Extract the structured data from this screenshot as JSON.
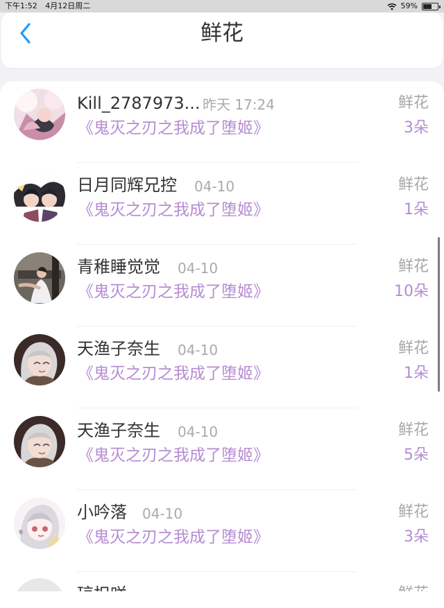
{
  "status_bar": {
    "time": "下午1:52",
    "date": "4月12日周二",
    "battery": "59%",
    "battery_level_percent": 59,
    "icons": [
      "wifi-icon",
      "battery-icon"
    ]
  },
  "header": {
    "title": "鲜花",
    "back_icon": "chevron-left-icon"
  },
  "list": [
    {
      "name": "Kill_2787973...",
      "time": "昨天 17:24",
      "book": "《鬼灭之刃之我成了堕姬》",
      "gift": "鲜花",
      "count": "3朵",
      "avatar": "avatar-kill"
    },
    {
      "name": "日月同辉兄控",
      "time": "04-10",
      "book": "《鬼灭之刃之我成了堕姬》",
      "gift": "鲜花",
      "count": "1朵",
      "avatar": "avatar-sun-moon"
    },
    {
      "name": "青稚睡觉觉",
      "time": "04-10",
      "book": "《鬼灭之刃之我成了堕姬》",
      "gift": "鲜花",
      "count": "10朵",
      "avatar": "avatar-qingzhi"
    },
    {
      "name": "天渔子奈生",
      "time": "04-10",
      "book": "《鬼灭之刃之我成了堕姬》",
      "gift": "鲜花",
      "count": "1朵",
      "avatar": "avatar-tianyu"
    },
    {
      "name": "天渔子奈生",
      "time": "04-10",
      "book": "《鬼灭之刃之我成了堕姬》",
      "gift": "鲜花",
      "count": "5朵",
      "avatar": "avatar-tianyu"
    },
    {
      "name": "小吟落",
      "time": "04-10",
      "book": "《鬼灭之刃之我成了堕姬》",
      "gift": "鲜花",
      "count": "3朵",
      "avatar": "avatar-xiaoyinluo"
    }
  ],
  "partial_row": {
    "name": "琼担咲",
    "gift": "鲜花"
  },
  "colors": {
    "background": "#f2f2f4",
    "card": "#ffffff",
    "accent_blue": "#1a9bff",
    "primary_text": "#333333",
    "secondary_text": "#aaaaaa",
    "purple_text": "#b58cd2",
    "status_bar": "#d9d9d9"
  }
}
